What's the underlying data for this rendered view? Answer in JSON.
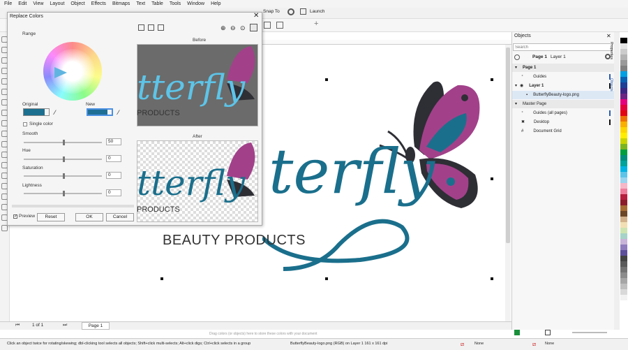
{
  "menu": [
    "File",
    "Edit",
    "View",
    "Layout",
    "Object",
    "Effects",
    "Bitmaps",
    "Text",
    "Table",
    "Tools",
    "Window",
    "Help"
  ],
  "propbar": {
    "snap_to": "Snap To",
    "launch": "Launch"
  },
  "dialog": {
    "title": "Replace Colors",
    "range_label": "Range",
    "original_label": "Original",
    "new_label": "New",
    "single_color_label": "Single color",
    "smooth_label": "Smooth",
    "smooth_value": "50",
    "hue_label": "Hue",
    "hue_value": "0",
    "saturation_label": "Saturation",
    "saturation_value": "0",
    "lightness_label": "Lightness",
    "lightness_value": "0",
    "preview_label": "Preview",
    "reset_label": "Reset",
    "ok_label": "OK",
    "cancel_label": "Cancel",
    "before_label": "Before",
    "after_label": "After",
    "original_color": "#1c6f8f",
    "new_color": "#1e6f95"
  },
  "canvas": {
    "logo_word": "terfly",
    "tagline": "BEAUTY PRODUCTS",
    "preview_word": "tterfly",
    "preview_tagline": "PRODUCTS"
  },
  "objects_panel": {
    "title": "Objects",
    "search_placeholder": "Search",
    "page_header": "Page 1",
    "layer_header": "Layer 1",
    "rows": {
      "page": "Page 1",
      "guides": "Guides",
      "layer": "Layer 1",
      "file": "ButterflyBeauty-logo.png",
      "master": "Master Page",
      "guides_all": "Guides (all pages)",
      "desktop": "Desktop",
      "grid": "Document Grid"
    },
    "side_tabs": {
      "properties": "Properties",
      "objects": "Objects"
    }
  },
  "pagebar": {
    "counter": "1 of 1",
    "tab": "Page 1",
    "hint": "Drag colors (or objects) here to store these colors with your document"
  },
  "status": {
    "hint": "Click an object twice for rotating/skewing; dbl-clicking tool selects all objects; Shift+click multi-selects; Alt+click digs; Ctrl+click selects in a group",
    "info": "ButterflyBeauty-logo.png (RGB) on Layer 1 161 x 161 dpi",
    "fill": "None",
    "outline": "None"
  },
  "colors": {
    "teal": "#1a6f8c",
    "purple": "#a2418a",
    "dark": "#2e2e35",
    "accent": "#2a5db0"
  },
  "palette": [
    "#ffffff",
    "#000000",
    "#e6e6e6",
    "#cccccc",
    "#b3b3b3",
    "#999999",
    "#808080",
    "#00a0e3",
    "#0a61b2",
    "#1d3f96",
    "#3c2883",
    "#6d2584",
    "#e5007d",
    "#e4003a",
    "#e20613",
    "#ee7203",
    "#f9b000",
    "#fdd500",
    "#ffed00",
    "#c8d400",
    "#7ab51d",
    "#009e3d",
    "#008d7c",
    "#00a29a",
    "#00b3e3",
    "#5dc4e8",
    "#9ad4ef",
    "#f6b7c8",
    "#f07d9b",
    "#b71f3e",
    "#8b1b2a",
    "#a66b33",
    "#6d4626",
    "#d3b28b",
    "#f2e0b4",
    "#cde4b1",
    "#a6d3c7",
    "#c7b4d8",
    "#8e7cbd",
    "#5e4f9b",
    "#434343",
    "#5a5a5a",
    "#737373",
    "#8c8c8c",
    "#a6a6a6",
    "#bfbfbf",
    "#d9d9d9",
    "#f2f2f2"
  ]
}
